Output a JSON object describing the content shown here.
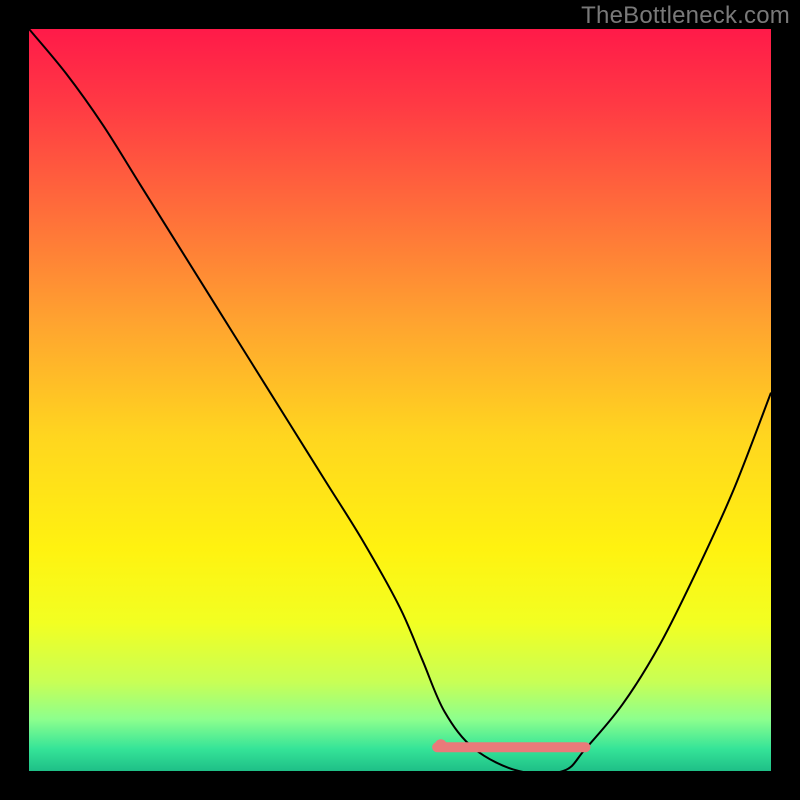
{
  "watermark": "TheBottleneck.com",
  "chart_data": {
    "type": "line",
    "title": "",
    "xlabel": "",
    "ylabel": "",
    "xlim": [
      0,
      100
    ],
    "ylim": [
      0,
      100
    ],
    "background": {
      "type": "vertical-gradient",
      "stops": [
        {
          "offset": 0.0,
          "color": "#ff1a49"
        },
        {
          "offset": 0.1,
          "color": "#ff3944"
        },
        {
          "offset": 0.25,
          "color": "#ff6f3a"
        },
        {
          "offset": 0.4,
          "color": "#ffa52f"
        },
        {
          "offset": 0.55,
          "color": "#ffd61f"
        },
        {
          "offset": 0.7,
          "color": "#fff210"
        },
        {
          "offset": 0.8,
          "color": "#f2ff22"
        },
        {
          "offset": 0.88,
          "color": "#c8ff55"
        },
        {
          "offset": 0.93,
          "color": "#8dff8d"
        },
        {
          "offset": 0.97,
          "color": "#35e498"
        },
        {
          "offset": 1.0,
          "color": "#1fbf87"
        }
      ]
    },
    "series": [
      {
        "name": "bottleneck-curve",
        "color": "#000000",
        "width": 2,
        "x": [
          0,
          5,
          10,
          15,
          20,
          25,
          30,
          35,
          40,
          45,
          50,
          53,
          56,
          60,
          66,
          72,
          75,
          80,
          85,
          90,
          95,
          100
        ],
        "y": [
          100,
          94,
          87,
          79,
          71,
          63,
          55,
          47,
          39,
          31,
          22,
          15,
          8,
          3,
          0,
          0,
          3,
          9,
          17,
          27,
          38,
          51
        ]
      }
    ],
    "pink_band": {
      "name": "optimal-range",
      "color": "#e97a7a",
      "y": 3.2,
      "x_start": 55,
      "x_end": 75,
      "dot_x": 55.5,
      "dot_r": 6,
      "thickness": 10
    }
  }
}
